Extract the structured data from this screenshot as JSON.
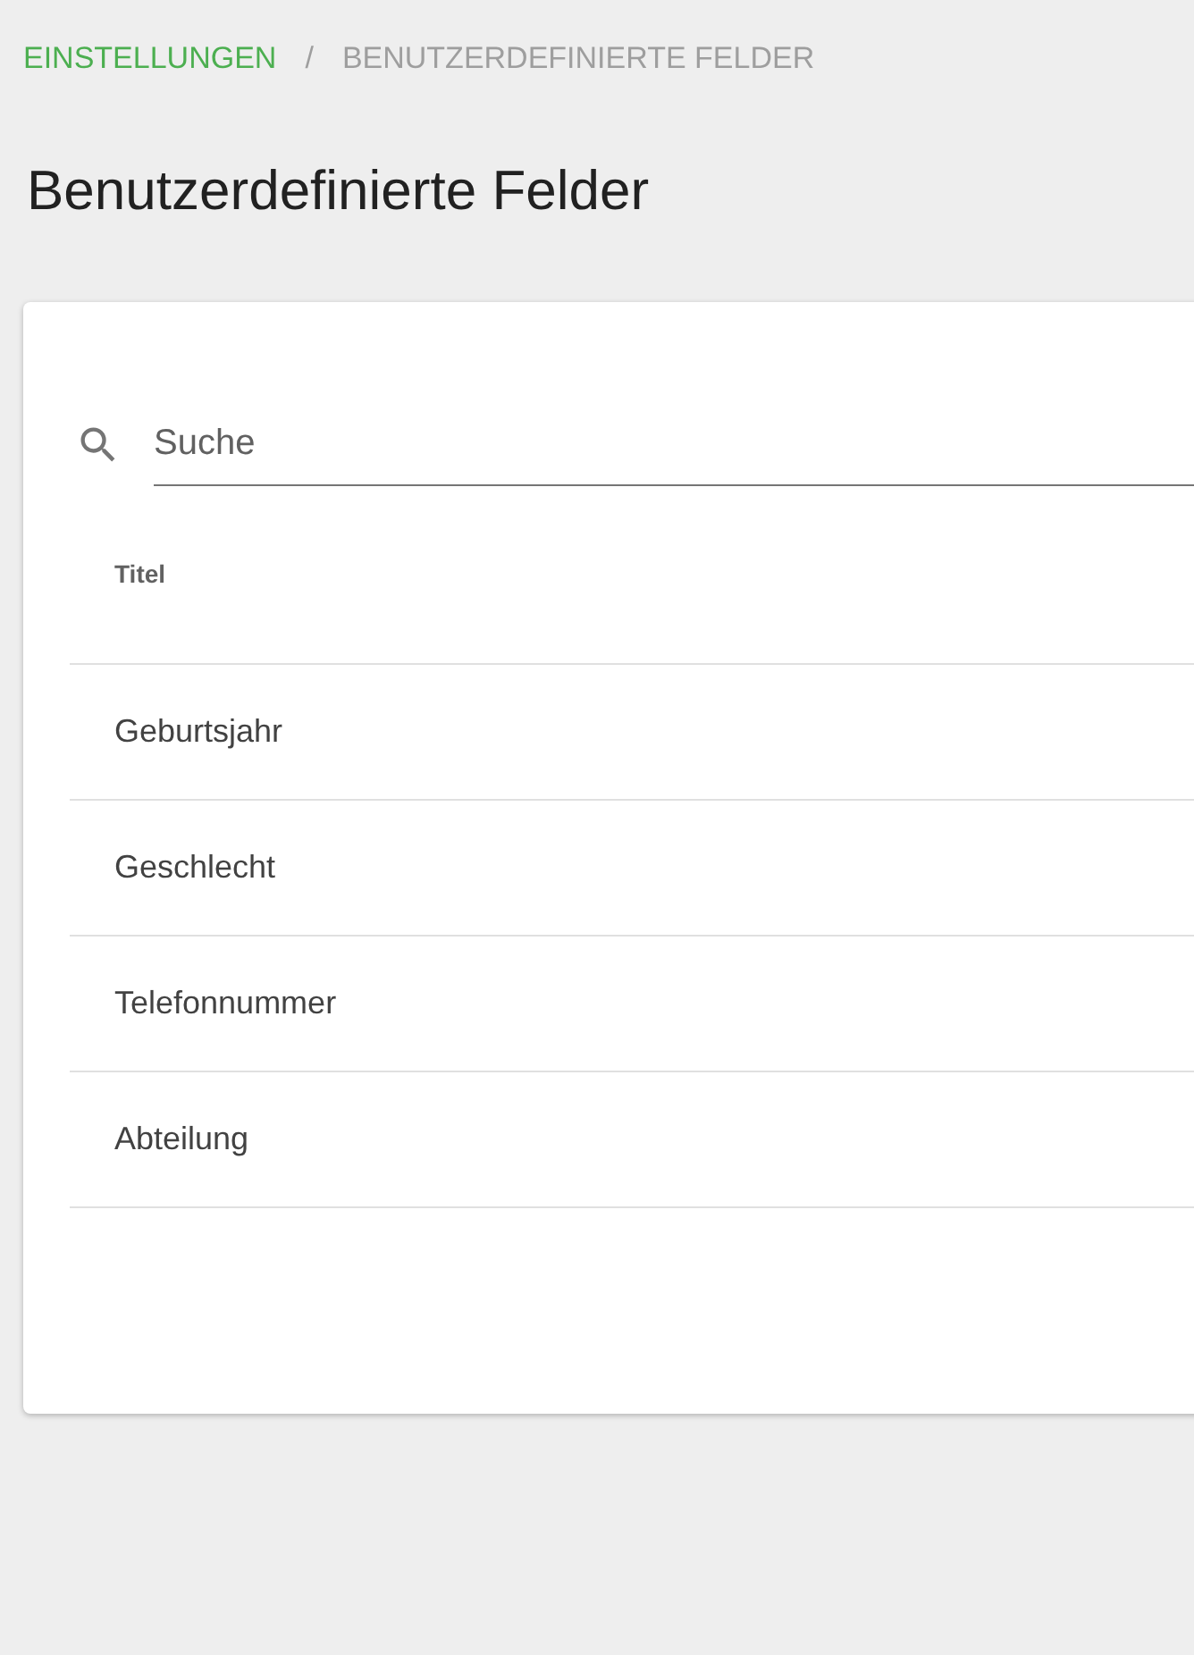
{
  "breadcrumb": [
    {
      "label": "EINSTELLUNGEN",
      "selected": false
    },
    {
      "label": "BENUTZERDEFINIERTE FELDER",
      "selected": true
    }
  ],
  "breadcrumb_separator": "/",
  "title": "Benutzerdefinierte Felder",
  "search": {
    "placeholder": "Suche"
  },
  "table": {
    "columns": [
      "Titel"
    ],
    "rows": [
      [
        "Geburtsjahr"
      ],
      [
        "Geschlecht"
      ],
      [
        "Telefonnummer"
      ],
      [
        "Abteilung"
      ]
    ]
  }
}
